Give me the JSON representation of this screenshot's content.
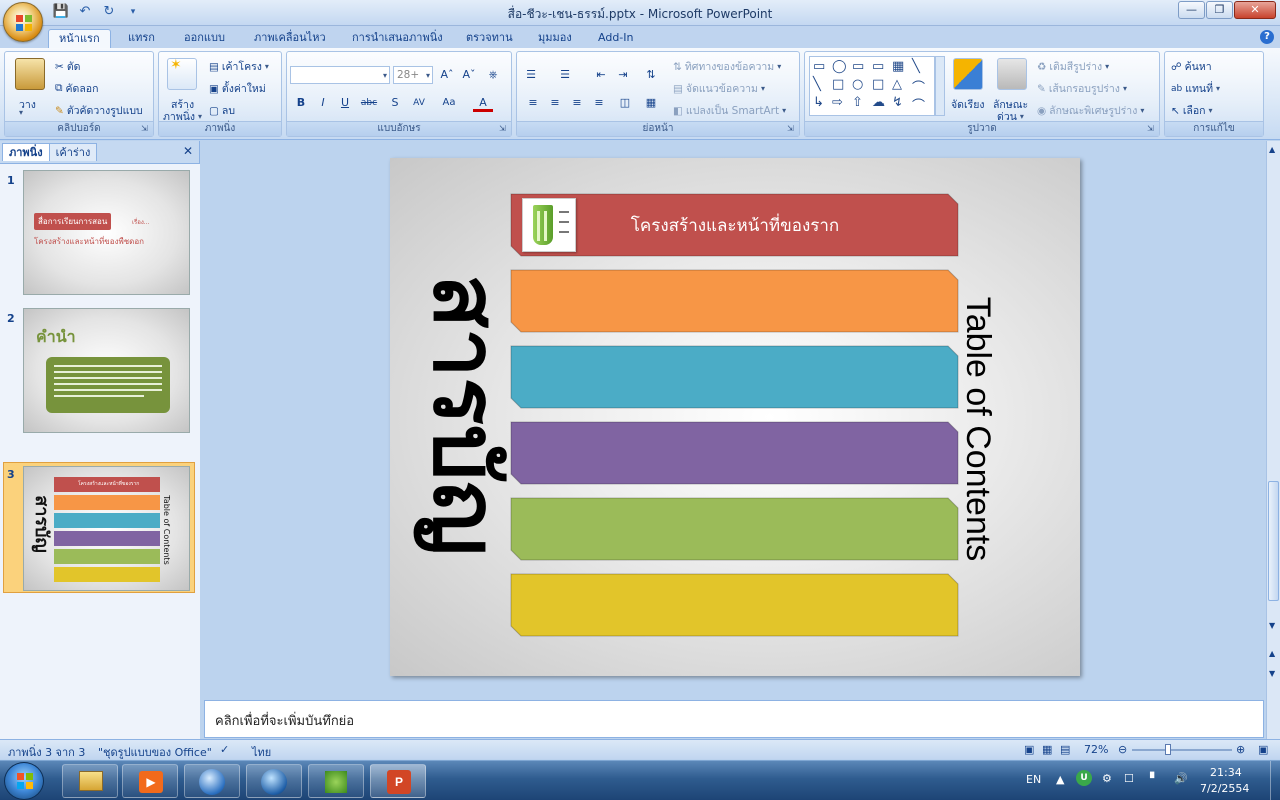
{
  "window": {
    "title": "สื่อ-ชีวะ-เชน-ธรรม์.pptx - Microsoft PowerPoint"
  },
  "ribbon_tabs": [
    "หน้าแรก",
    "แทรก",
    "ออกแบบ",
    "ภาพเคลื่อนไหว",
    "การนำเสนอภาพนิ่ง",
    "ตรวจทาน",
    "มุมมอง",
    "Add-In"
  ],
  "clipboard": {
    "paste": "วาง",
    "cut": "ตัด",
    "copy": "คัดลอก",
    "format_painter": "ตัวคัดวางรูปแบบ",
    "label": "คลิปบอร์ด"
  },
  "slides_group": {
    "new_slide_1": "สร้าง",
    "new_slide_2": "ภาพนิ่ง",
    "layout": "เค้าโครง",
    "reset": "ตั้งค่าใหม่",
    "delete": "ลบ",
    "label": "ภาพนิ่ง"
  },
  "font_group": {
    "font_size": "28+",
    "label": "แบบอักษร"
  },
  "paragraph_group": {
    "text_direction": "ทิศทางของข้อความ",
    "align_text": "จัดแนวข้อความ",
    "smartart": "แปลงเป็น SmartArt",
    "label": "ย่อหน้า"
  },
  "drawing_group": {
    "arrange": "จัดเรียง",
    "quick_styles_1": "ลักษณะ",
    "quick_styles_2": "ด่วน",
    "shape_fill": "เติมสีรูปร่าง",
    "shape_outline": "เส้นกรอบรูปร่าง",
    "shape_effects": "ลักษณะพิเศษรูปร่าง",
    "label": "รูปวาด"
  },
  "editing_group": {
    "find": "ค้นหา",
    "replace": "แทนที่",
    "select": "เลือก",
    "label": "การแก้ไข"
  },
  "left_pane": {
    "tab_slides": "ภาพนิ่ง",
    "tab_outline": "เค้าร่าง",
    "thumb1": {
      "num": "1",
      "title": "สื่อการเรียนการสอน",
      "sub": "เรื่อง...",
      "subtitle": "โครงสร้างและหน้าที่ของพืชดอก"
    },
    "thumb2": {
      "num": "2",
      "title": "คำนำ"
    },
    "thumb3": {
      "num": "3",
      "title": "สารบัญ",
      "side": "Table of Contents",
      "header": "โครงสร้างและหน้าที่ของราก"
    }
  },
  "slide": {
    "title_thai": "สารบัญ",
    "title_en": "Table of Contents",
    "items": [
      {
        "label": "โครงสร้างและหน้าที่ของราก",
        "color": "#c0504d"
      },
      {
        "label": "",
        "color": "#f79646"
      },
      {
        "label": "",
        "color": "#4bacc6"
      },
      {
        "label": "",
        "color": "#8064a2"
      },
      {
        "label": "",
        "color": "#9bbb59"
      },
      {
        "label": "",
        "color": "#e2c52a"
      }
    ]
  },
  "notes": {
    "placeholder": "คลิกเพื่อที่จะเพิ่มบันทึกย่อ"
  },
  "status": {
    "slide_count": "ภาพนิ่ง 3 จาก 3",
    "theme": "\"ชุดรูปแบบของ Office\"",
    "language": "ไทย",
    "zoom": "72%"
  },
  "taskbar": {
    "lang": "EN",
    "time": "21:34",
    "date": "7/2/2554"
  }
}
